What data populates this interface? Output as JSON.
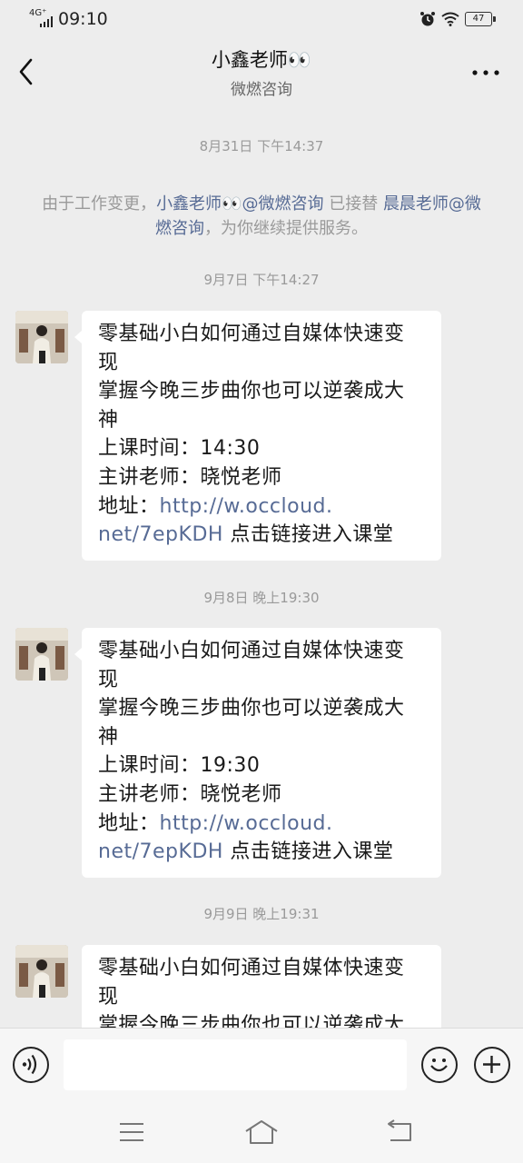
{
  "status_bar": {
    "network": "4G⁺",
    "time": "09:10",
    "battery": "47"
  },
  "header": {
    "title": "小鑫老师👀",
    "subtitle": "微燃咨询",
    "more_icon": "more-dots-icon",
    "back_icon": "back-arrow-icon"
  },
  "system_note": {
    "timestamp": "8月31日 下午14:37",
    "part1": "由于工作变更，",
    "link1": "小鑫老师👀@微燃咨询",
    "part2": " 已接替 ",
    "link2": "晨晨老师@微燃咨询",
    "part3": "，为你继续提供服务。"
  },
  "messages": [
    {
      "timestamp": "9月7日 下午14:27",
      "lines": [
        "零基础小白如何通过自媒体快速变",
        "现",
        "掌握今晚三步曲你也可以逆袭成大",
        "神",
        "上课时间：14:30",
        "主讲老师：晓悦老师"
      ],
      "addr_label": "地址：",
      "url_part1": "http://w.occloud.",
      "url_part2": "net/7epKDH",
      "tail": " 点击链接进入课堂"
    },
    {
      "timestamp": "9月8日 晚上19:30",
      "lines": [
        "零基础小白如何通过自媒体快速变",
        "现",
        "掌握今晚三步曲你也可以逆袭成大",
        "神",
        "上课时间：19:30",
        "主讲老师：晓悦老师"
      ],
      "addr_label": "地址：",
      "url_part1": "http://w.occloud.",
      "url_part2": "net/7epKDH",
      "tail": " 点击链接进入课堂"
    },
    {
      "timestamp": "9月9日 晚上19:31",
      "lines": [
        "零基础小白如何通过自媒体快速变",
        "现",
        "掌握今晚三步曲你也可以逆袭成大"
      ]
    }
  ],
  "input_bar": {
    "voice_icon": "voice-icon",
    "emoji_icon": "emoji-icon",
    "plus_icon": "plus-icon",
    "input_value": ""
  },
  "colors": {
    "background": "#ededed",
    "link": "#576b95",
    "bubble": "#ffffff"
  }
}
